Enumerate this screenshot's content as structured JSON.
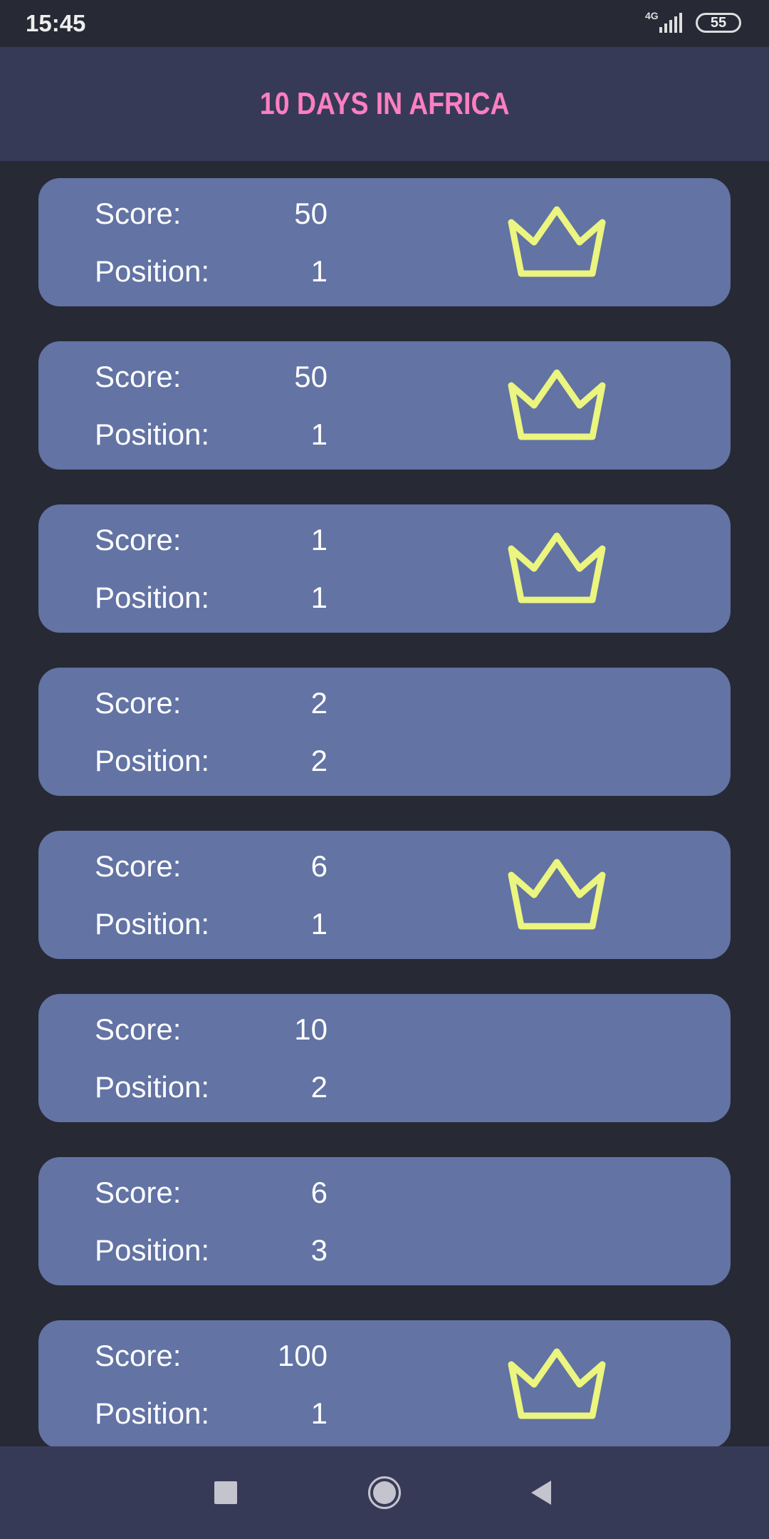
{
  "status_bar": {
    "time": "15:45",
    "network": "4G",
    "battery": "55"
  },
  "header": {
    "title": "10 DAYS IN AFRICA"
  },
  "labels": {
    "score": "Score:",
    "position": "Position:"
  },
  "colors": {
    "title": "#ff7ec1",
    "card": "#6273a4",
    "crown": "#ebf57f",
    "background": "#272935",
    "bar": "#373a57"
  },
  "entries": [
    {
      "score": "50",
      "position": "1",
      "crown": true
    },
    {
      "score": "50",
      "position": "1",
      "crown": true
    },
    {
      "score": "1",
      "position": "1",
      "crown": true
    },
    {
      "score": "2",
      "position": "2",
      "crown": false
    },
    {
      "score": "6",
      "position": "1",
      "crown": true
    },
    {
      "score": "10",
      "position": "2",
      "crown": false
    },
    {
      "score": "6",
      "position": "3",
      "crown": false
    },
    {
      "score": "100",
      "position": "1",
      "crown": true
    }
  ]
}
